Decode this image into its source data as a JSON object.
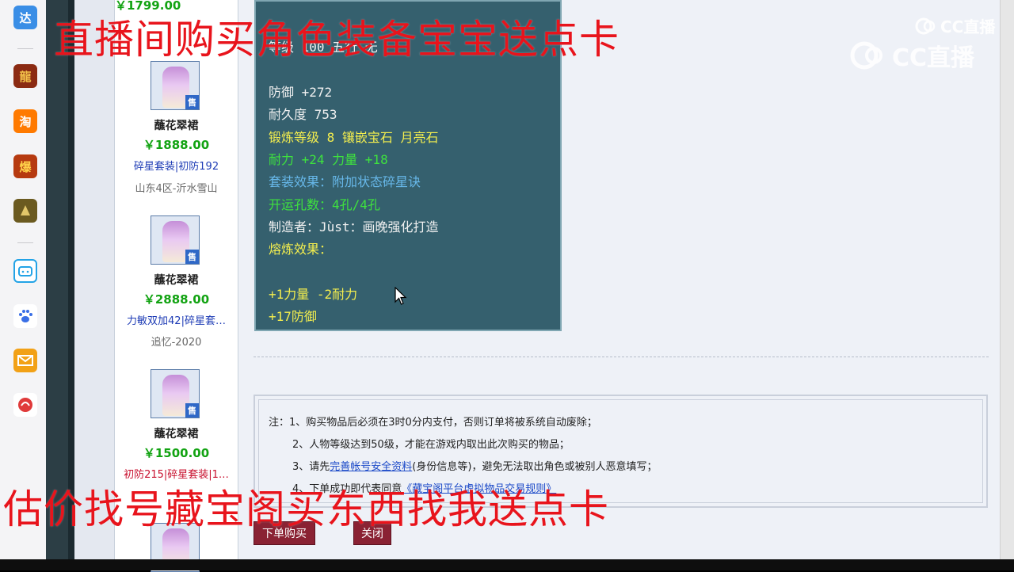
{
  "dock": {
    "items": [
      {
        "icon": "da-app-icon",
        "label": "达",
        "color": "#3a8ee6"
      },
      {
        "icon": "game-dragon-icon",
        "label": "龍",
        "color": "#8b2a12"
      },
      {
        "icon": "taobao-icon",
        "label": "淘",
        "color": "#ff7a00"
      },
      {
        "icon": "game-bao-icon",
        "label": "爆",
        "color": "#b63a10"
      },
      {
        "icon": "game-warrior-icon",
        "label": "",
        "color": "#6b5a20"
      },
      {
        "icon": "bilibili-icon",
        "label": "",
        "color": "#23a3e6"
      },
      {
        "icon": "baidu-paw-icon",
        "label": "",
        "color": "#3a6fe6"
      },
      {
        "icon": "mail-icon",
        "label": "",
        "color": "#f2a116"
      },
      {
        "icon": "netease-icon",
        "label": "",
        "color": "#e03a3a"
      }
    ]
  },
  "listing": {
    "top_price": "￥1799.00",
    "items": [
      {
        "name": "蘸花翠裙",
        "price": "￥1888.00",
        "tags": "碎星套装|初防192",
        "server": "山东4区-沂水雪山",
        "sell_badge": "售",
        "tag_color": "#1d3bb5"
      },
      {
        "name": "蘸花翠裙",
        "price": "￥2888.00",
        "tags": "力敏双加42|碎星套…",
        "server": "追忆-2020",
        "sell_badge": "售",
        "tag_color": "#1d3bb5"
      },
      {
        "name": "蘸花翠裙",
        "price": "￥1500.00",
        "tags": "初防215|碎星套装|1…",
        "server": "",
        "sell_badge": "售",
        "tag_color": "#c8102e"
      }
    ]
  },
  "tooltip": {
    "line_level": "等级 100 五行 无",
    "defense": "防御 +272",
    "durability": "耐久度 753",
    "forge": "锻炼等级 8 镶嵌宝石 月亮石",
    "bonus": "耐力 +24 力量 +18",
    "set_effect": "套装效果：附加状态碎星诀",
    "slots": "开运孔数：4孔/4孔",
    "maker": "制造者：Jùst：画晚强化打造",
    "smelt_title": "熔炼效果：",
    "smelt_1": "+1力量 -2耐力",
    "smelt_2": "+17防御"
  },
  "notice": {
    "line1": "注：1、购买物品后必须在3时0分内支付，否则订单将被系统自动废除；",
    "line2": "2、人物等级达到50级，才能在游戏内取出此次购买的物品；",
    "line3_pre": "3、请先",
    "line3_link": "完善帐号安全资料",
    "line3_post": "(身份信息等)，避免无法取出角色或被别人恶意填写；",
    "line4_pre": "4、下单成功即代表同意",
    "line4_link": "《藏宝阁平台虚拟物品交易规则》"
  },
  "buttons": {
    "order": "下单购买",
    "close": "关闭"
  },
  "overlay": {
    "top_caption": "直播间购买角色装备宝宝送点卡",
    "bottom_caption": "估价找号藏宝阁买东西找我送点卡",
    "caption_color": "#e8141c"
  },
  "watermark": {
    "small": "CC直播",
    "large": "CC直播"
  }
}
